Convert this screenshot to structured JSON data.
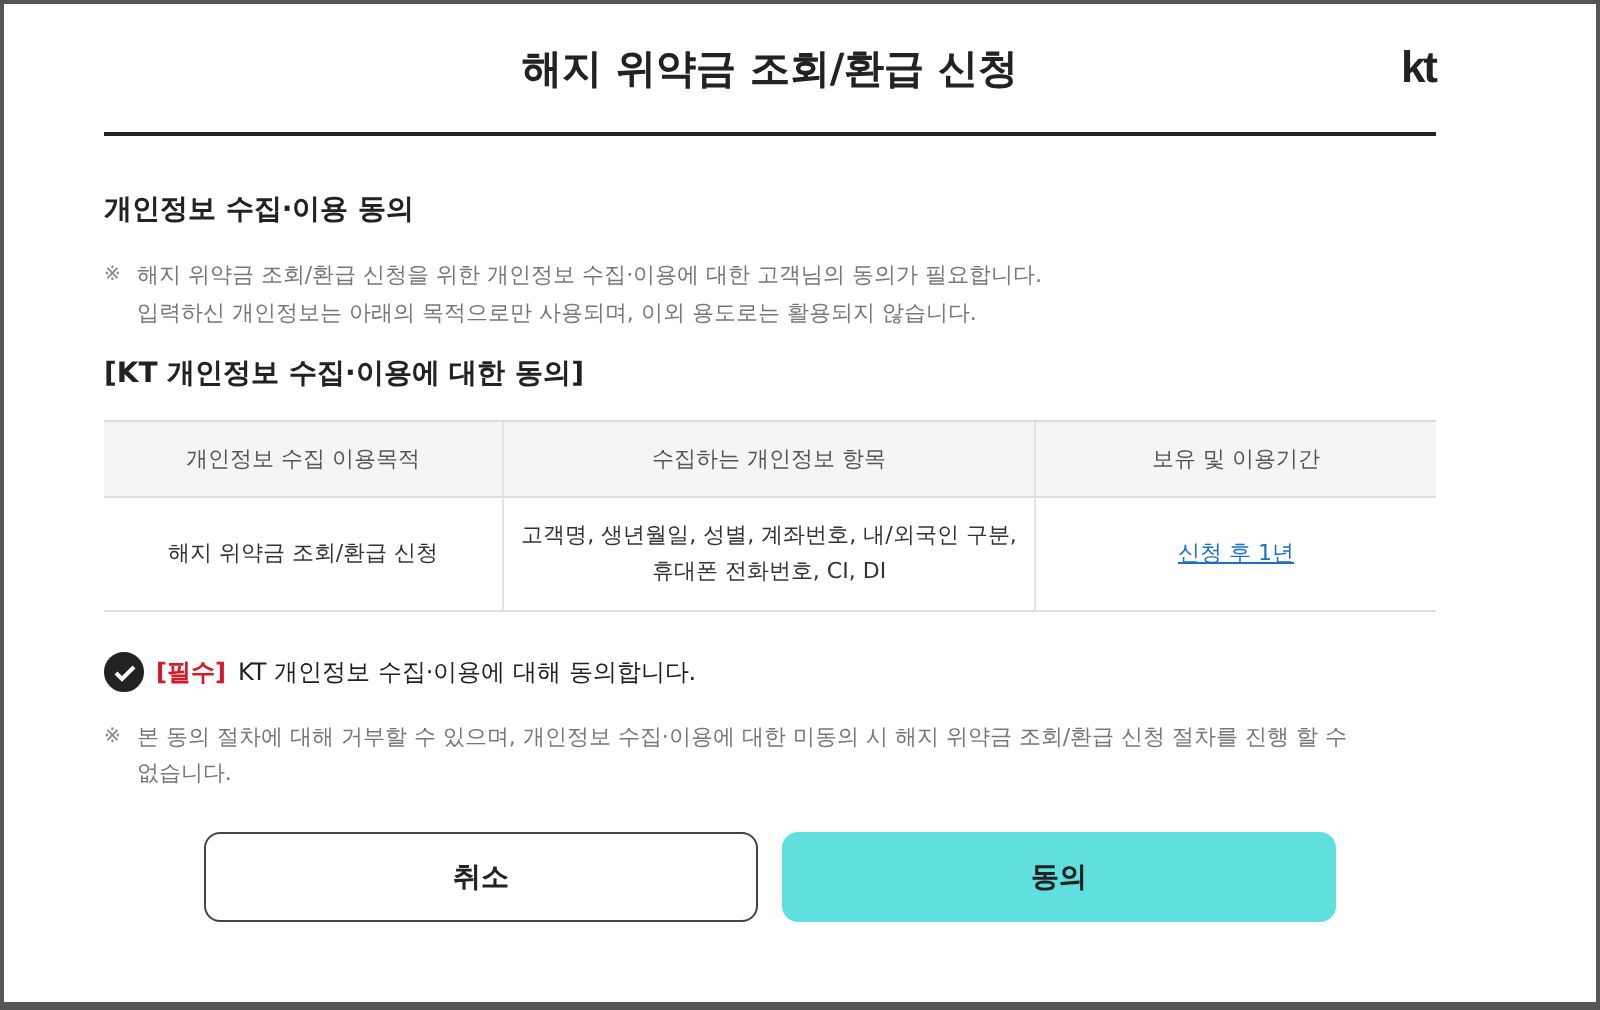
{
  "header": {
    "title": "해지 위약금 조회/환급 신청",
    "logo": "kt"
  },
  "section": {
    "heading": "개인정보 수집·이용 동의",
    "notice": {
      "mark": "※",
      "lines": [
        "해지 위약금 조회/환급 신청을 위한 개인정보 수집·이용에 대한 고객님의 동의가 필요합니다.",
        "입력하신 개인정보는 아래의 목적으로만 사용되며, 이외 용도로는 활용되지 않습니다."
      ]
    },
    "subheading": "[KT 개인정보 수집·이용에 대한 동의]"
  },
  "table": {
    "columns": [
      "개인정보 수집 이용목적",
      "수집하는 개인정보 항목",
      "보유 및 이용기간"
    ],
    "rows": [
      {
        "cells": [
          {
            "kind": "text",
            "text": "해지 위약금 조회/환급 신청"
          },
          {
            "kind": "text",
            "text": "고객명, 생년월일, 성별, 계좌번호, 내/외국인 구분, 휴대폰 전화번호, CI, DI"
          },
          {
            "kind": "link",
            "text": "신청 후 1년"
          }
        ]
      }
    ]
  },
  "consent": {
    "checked": true,
    "required": "[필수]",
    "label": "KT 개인정보 수집·이용에 대해 동의합니다."
  },
  "footnote": {
    "mark": "※",
    "text": "본 동의 절차에 대해 거부할 수 있으며, 개인정보 수집·이용에 대한 미동의 시 해지 위약금 조회/환급 신청 절차를 진행 할 수 없습니다."
  },
  "buttons": [
    {
      "kind": "secondary",
      "label": "취소"
    },
    {
      "kind": "primary",
      "label": "동의"
    }
  ]
}
